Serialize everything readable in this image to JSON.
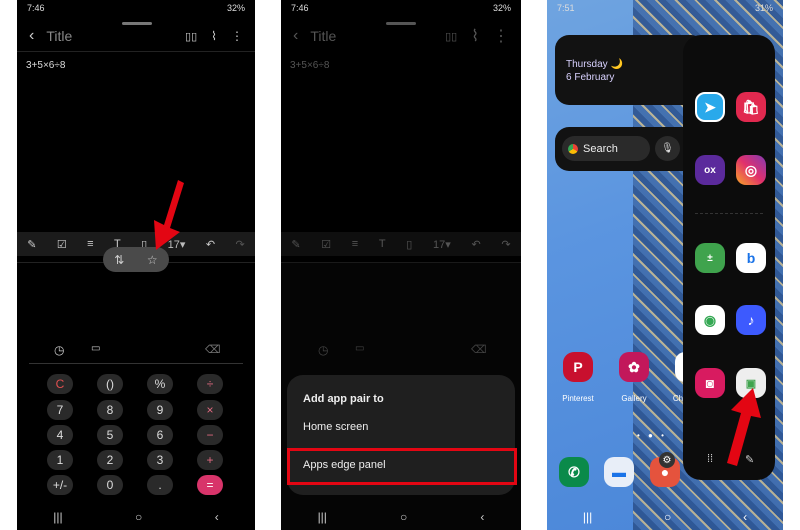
{
  "phone1": {
    "status": {
      "time": "7:46",
      "right": "32%"
    },
    "title": "Title",
    "note_text": "3+5×6÷8",
    "toolbar": {
      "font_size": "17▾"
    },
    "keypad": [
      [
        "C",
        "()",
        "%",
        "÷"
      ],
      [
        "7",
        "8",
        "9",
        "×"
      ],
      [
        "4",
        "5",
        "6",
        "−"
      ],
      [
        "1",
        "2",
        "3",
        "+"
      ],
      [
        "+/-",
        "0",
        ".",
        "="
      ]
    ]
  },
  "phone2": {
    "status": {
      "time": "7:46",
      "right": "32%"
    },
    "title": "Title",
    "note_text": "3+5×6÷8",
    "toolbar": {
      "font_size": "17▾"
    },
    "sheet": {
      "heading": "Add app pair to",
      "option_home": "Home screen",
      "option_edge": "Apps edge panel"
    }
  },
  "phone3": {
    "status": {
      "time": "7:51",
      "right": "31%"
    },
    "widget": {
      "day": "Thursday 🌙",
      "date": "6 February"
    },
    "search": {
      "placeholder": "Search"
    },
    "apps": [
      {
        "label": "Pinterest"
      },
      {
        "label": "Gallery"
      },
      {
        "label": "Ch"
      }
    ]
  },
  "colors": {
    "highlight": "#e30613",
    "accent_pink": "#d8346a"
  }
}
